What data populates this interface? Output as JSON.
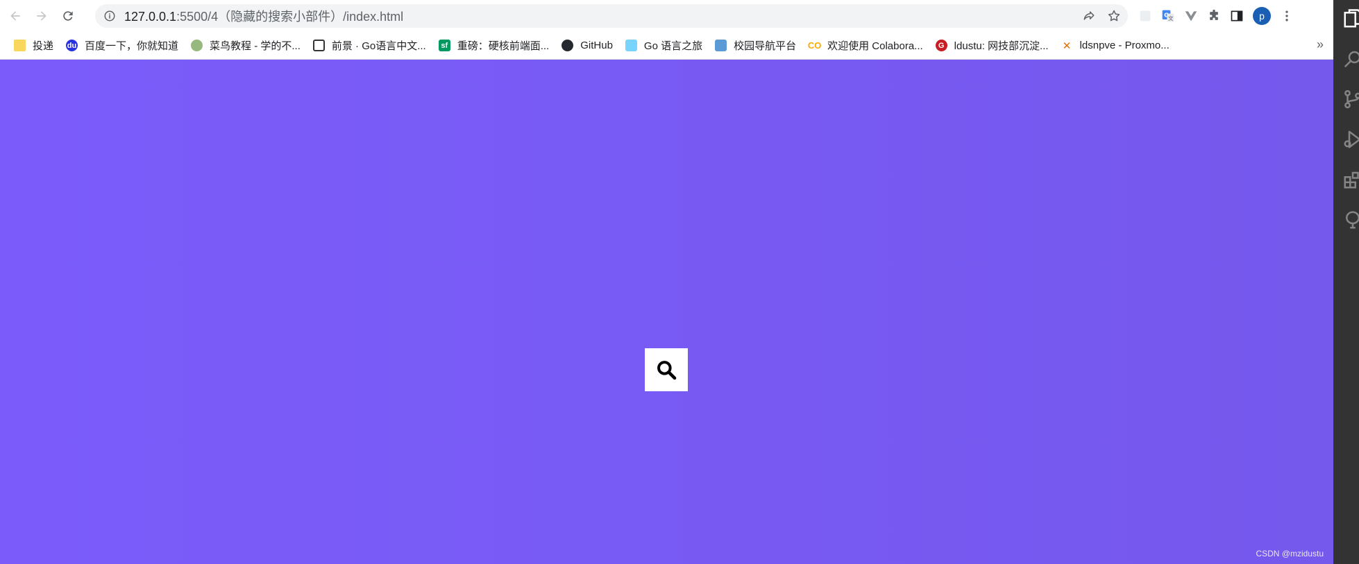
{
  "browser": {
    "url_host": "127.0.0.1",
    "url_rest": ":5500/4（隐藏的搜索小部件）/index.html",
    "profile_initial": "p",
    "bookmarks": [
      {
        "label": "投递",
        "icon": "folder-icon",
        "color": "#f9d65c"
      },
      {
        "label": "百度一下，你就知道",
        "icon": "baidu-icon",
        "color": "#2932e1"
      },
      {
        "label": "菜鸟教程 - 学的不...",
        "icon": "runoob-icon",
        "color": "#96b97d"
      },
      {
        "label": "前景 · Go语言中文...",
        "icon": "book-icon",
        "color": "#333333"
      },
      {
        "label": "重磅：硬核前端面...",
        "icon": "sf-icon",
        "color": "#009a61"
      },
      {
        "label": "GitHub",
        "icon": "github-icon",
        "color": "#24292f"
      },
      {
        "label": "Go 语言之旅",
        "icon": "gopher-icon",
        "color": "#79d4fd"
      },
      {
        "label": "校园导航平台",
        "icon": "campus-icon",
        "color": "#5b9bd5"
      },
      {
        "label": "欢迎使用 Colabora...",
        "icon": "colab-icon",
        "color": "#f9ab00"
      },
      {
        "label": "ldustu: 网技部沉淀...",
        "icon": "gitee-icon",
        "color": "#c71d23"
      },
      {
        "label": "ldsnpve - Proxmo...",
        "icon": "proxmox-icon",
        "color": "#e57000"
      }
    ],
    "more_label": "»"
  },
  "page": {
    "background_start": "#7b5cfb",
    "background_end": "#7558ec"
  },
  "watermark": "CSDN @mzidustu"
}
